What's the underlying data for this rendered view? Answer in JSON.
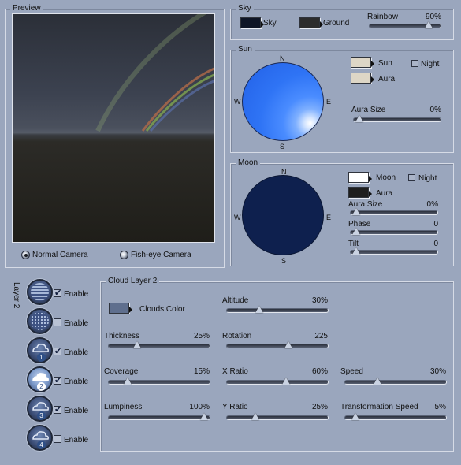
{
  "preview": {
    "title": "Preview",
    "camera_options": [
      {
        "label": "Normal Camera",
        "selected": true
      },
      {
        "label": "Fish-eye Camera",
        "selected": false
      }
    ]
  },
  "sky": {
    "title": "Sky",
    "sky_label": "Sky",
    "sky_color": "#0e1526",
    "ground_label": "Ground",
    "ground_color": "#2d2d2d",
    "rainbow_label": "Rainbow",
    "rainbow_value": "90%",
    "rainbow_fraction": 0.9
  },
  "sun": {
    "title": "Sun",
    "sun_label": "Sun",
    "sun_color": "#ddd6c6",
    "aura_label": "Aura",
    "aura_color": "#ddd6c6",
    "night_label": "Night",
    "night_checked": false,
    "aura_size_label": "Aura Size",
    "aura_size_value": "0%",
    "aura_size_fraction": 0.0,
    "compass": {
      "n": "N",
      "s": "S",
      "e": "E",
      "w": "W"
    }
  },
  "moon": {
    "title": "Moon",
    "moon_label": "Moon",
    "moon_color": "#ffffff",
    "aura_label": "Aura",
    "aura_color": "#1e1e1e",
    "night_label": "Night",
    "night_checked": false,
    "aura_size_label": "Aura Size",
    "aura_size_value": "0%",
    "aura_size_fraction": 0.0,
    "phase_label": "Phase",
    "phase_value": "0",
    "phase_fraction": 0.0,
    "tilt_label": "Tilt",
    "tilt_value": "0",
    "tilt_fraction": 0.0,
    "compass": {
      "n": "N",
      "s": "S",
      "e": "E",
      "w": "W"
    }
  },
  "layers": {
    "title": "Layer 2",
    "enable_label": "Enable",
    "items": [
      {
        "icon": "layer-striped-icon",
        "enabled": true
      },
      {
        "icon": "layer-dotted-icon",
        "enabled": false
      },
      {
        "icon": "cloud-layer-1-icon",
        "number": "1",
        "enabled": true
      },
      {
        "icon": "cloud-layer-2-icon",
        "number": "2",
        "enabled": true
      },
      {
        "icon": "cloud-layer-3-icon",
        "number": "3",
        "enabled": true
      },
      {
        "icon": "cloud-layer-4-icon",
        "number": "4",
        "enabled": false
      }
    ]
  },
  "cloud_layer": {
    "title": "Cloud Layer 2",
    "clouds_color_label": "Clouds Color",
    "clouds_color": "#5f6f8e",
    "altitude_label": "Altitude",
    "altitude_value": "30%",
    "altitude_fraction": 0.3,
    "thickness_label": "Thickness",
    "thickness_value": "25%",
    "thickness_fraction": 0.25,
    "rotation_label": "Rotation",
    "rotation_value": "225",
    "rotation_fraction": 0.625,
    "coverage_label": "Coverage",
    "coverage_value": "15%",
    "coverage_fraction": 0.15,
    "x_ratio_label": "X Ratio",
    "x_ratio_value": "60%",
    "x_ratio_fraction": 0.6,
    "speed_label": "Speed",
    "speed_value": "30%",
    "speed_fraction": 0.3,
    "lumpiness_label": "Lumpiness",
    "lumpiness_value": "100%",
    "lumpiness_fraction": 1.0,
    "y_ratio_label": "Y Ratio",
    "y_ratio_value": "25%",
    "y_ratio_fraction": 0.25,
    "transformation_speed_label": "Transformation Speed",
    "transformation_speed_value": "5%",
    "transformation_speed_fraction": 0.05
  }
}
